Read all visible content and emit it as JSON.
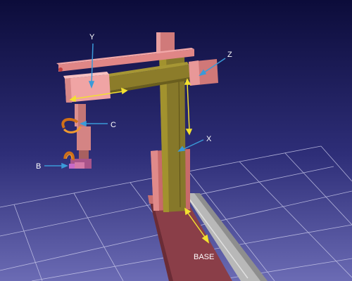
{
  "labels": {
    "y": "Y",
    "z": "Z",
    "c": "C",
    "x": "X",
    "b": "B",
    "base": "BASE"
  },
  "colors": {
    "background_top": "#14144a",
    "background_bottom": "#6a6ab0",
    "grid": "#c8c8e8",
    "frame_pink": "#e48a8a",
    "frame_dark": "#b06060",
    "beam_olive": "#8c7c2a",
    "beam_olive_dark": "#6e6020",
    "carriage_pink": "#f0a0a0",
    "callout": "#3a9ad8",
    "axis_arrow": "#f2e030",
    "rail": "#bcbcbc",
    "rotation_marker": "#d07018"
  }
}
